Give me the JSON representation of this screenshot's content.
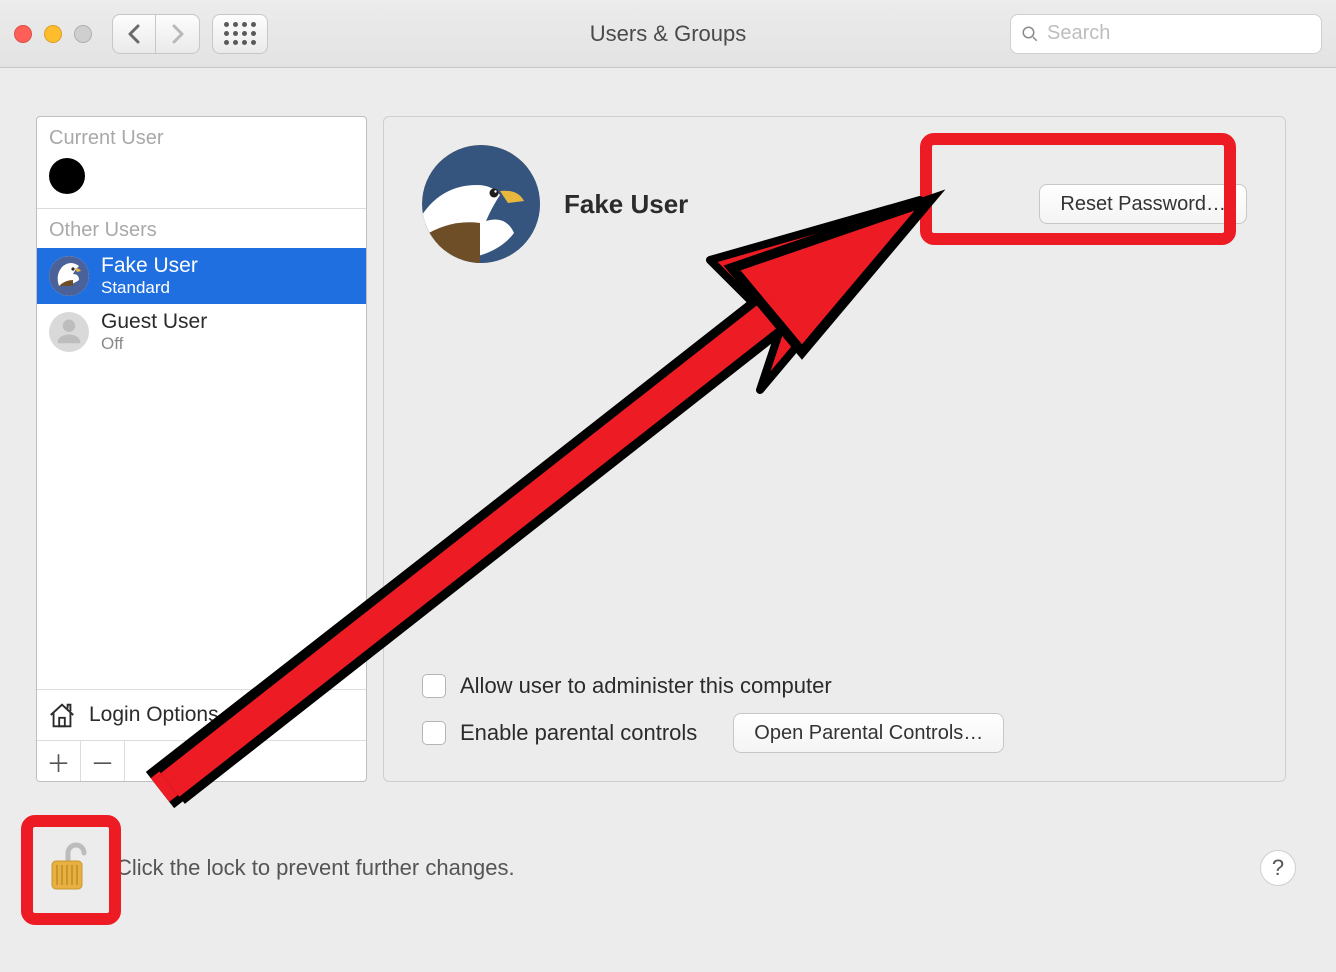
{
  "window": {
    "title": "Users & Groups",
    "search_placeholder": "Search"
  },
  "sidebar": {
    "current_label": "Current User",
    "other_label": "Other Users",
    "users": [
      {
        "name": "Fake User",
        "role": "Standard",
        "selected": true,
        "avatar": "eagle"
      },
      {
        "name": "Guest User",
        "role": "Off",
        "selected": false,
        "avatar": "silhouette"
      }
    ],
    "login_options_label": "Login Options"
  },
  "panel": {
    "user_name": "Fake User",
    "reset_label": "Reset Password…",
    "admin_label": "Allow user to administer this computer",
    "parental_label": "Enable parental controls",
    "open_parental_label": "Open Parental Controls…"
  },
  "footer": {
    "lock_text": "Click the lock to prevent further changes.",
    "help_label": "?"
  },
  "annotations": {
    "highlight_reset_button": true,
    "highlight_lock_icon": true,
    "arrow_from_lock_to_reset": true,
    "color": "#ed1c24"
  }
}
